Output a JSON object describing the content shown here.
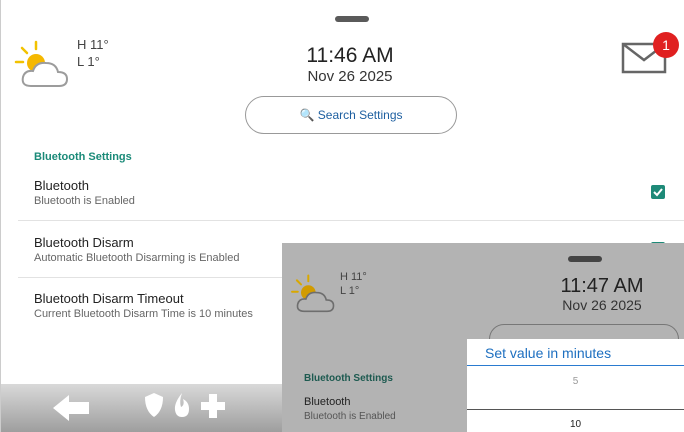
{
  "screen": {
    "weather": {
      "high": "H 11°",
      "low": "L 1°"
    },
    "time": "11:46 AM",
    "date": "Nov 26 2025",
    "messages_badge": "1",
    "search_label": "🔍 Search Settings"
  },
  "settings": {
    "section_title": "Bluetooth Settings",
    "items": [
      {
        "title": "Bluetooth",
        "subtitle": "Bluetooth is Enabled"
      },
      {
        "title": "Bluetooth Disarm",
        "subtitle": "Automatic Bluetooth Disarming is Enabled"
      },
      {
        "title": "Bluetooth Disarm Timeout",
        "subtitle": "Current Bluetooth Disarm Time is 10 minutes"
      }
    ]
  },
  "overlay": {
    "weather": {
      "high": "H 11°",
      "low": "L 1°"
    },
    "time": "11:47 AM",
    "date": "Nov 26 2025",
    "section_title": "Bluetooth Settings",
    "item_title": "Bluetooth",
    "item_subtitle": "Bluetooth is Enabled"
  },
  "picker": {
    "title": "Set value in minutes",
    "options": [
      "5",
      "10"
    ],
    "selected": "10"
  },
  "colors": {
    "accent": "#1e8a78",
    "badge": "#e02020",
    "link": "#1d6fc0"
  }
}
